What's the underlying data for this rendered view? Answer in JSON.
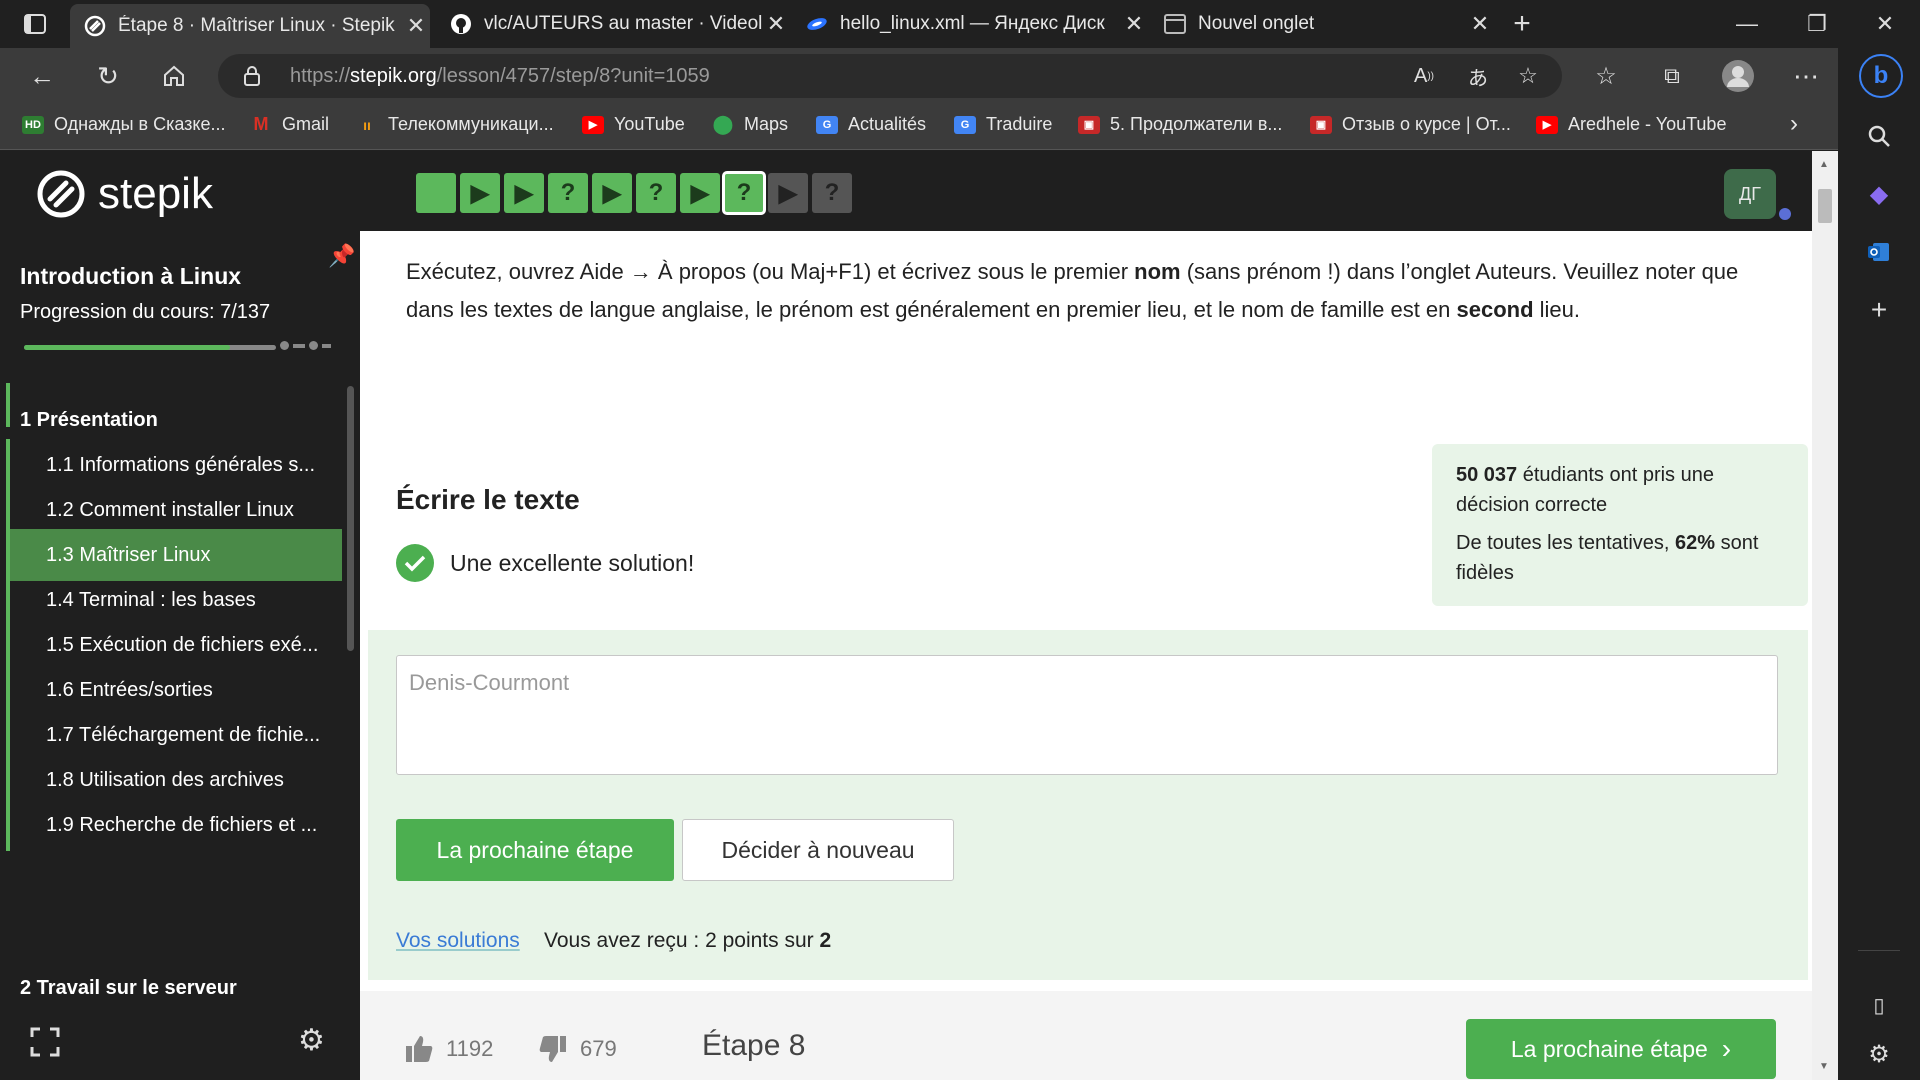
{
  "tabs": [
    {
      "title": "Étape 8 · Maîtriser Linux · Stepik",
      "active": true
    },
    {
      "title": "vlc/AUTEURS au master · Videola",
      "active": false
    },
    {
      "title": "hello_linux.xml — Яндекс Диск",
      "active": false
    },
    {
      "title": "Nouvel onglet",
      "active": false
    }
  ],
  "url": {
    "prefix": "https://",
    "domain": "stepik.org",
    "path": "/lesson/4757/step/8?unit=1059"
  },
  "bookmarks": [
    {
      "label": "Однажды в Сказке...",
      "icon": "hd-icon",
      "color": "#2e7d32"
    },
    {
      "label": "Gmail",
      "icon": "gmail-icon",
      "color": "#d93025"
    },
    {
      "label": "Телекоммуникаци...",
      "icon": "telecom-icon",
      "color": "#f39c12"
    },
    {
      "label": "YouTube",
      "icon": "youtube-icon",
      "color": "#ff0000"
    },
    {
      "label": "Maps",
      "icon": "maps-icon",
      "color": "#34a853"
    },
    {
      "label": "Actualités",
      "icon": "news-icon",
      "color": "#4285f4"
    },
    {
      "label": "Traduire",
      "icon": "translate-icon",
      "color": "#4285f4"
    },
    {
      "label": "5. Продолжатели в...",
      "icon": "video-icon",
      "color": "#c62828"
    },
    {
      "label": "Отзыв о курсе | От...",
      "icon": "video-icon",
      "color": "#c62828"
    },
    {
      "label": "Aredhele - YouTube",
      "icon": "youtube-icon",
      "color": "#ff0000"
    }
  ],
  "stepik": {
    "logo": "stepik",
    "avatar": "ДГ",
    "step_nav": [
      {
        "kind": "solid",
        "state": "green"
      },
      {
        "kind": "play",
        "state": "green"
      },
      {
        "kind": "play",
        "state": "green"
      },
      {
        "kind": "question",
        "state": "green"
      },
      {
        "kind": "play",
        "state": "green"
      },
      {
        "kind": "question",
        "state": "green"
      },
      {
        "kind": "play",
        "state": "green"
      },
      {
        "kind": "question",
        "state": "current"
      },
      {
        "kind": "play",
        "state": "gray"
      },
      {
        "kind": "question",
        "state": "gray"
      }
    ]
  },
  "sidebar": {
    "course_title": "Introduction à Linux",
    "progress_text": "Progression du cours: 7/137",
    "progress_fraction": 0.051,
    "sections": [
      {
        "title": "1 Présentation"
      },
      {
        "title": "2 Travail sur le serveur"
      }
    ],
    "lessons": [
      {
        "label": "1.1 Informations générales s...",
        "active": false
      },
      {
        "label": "1.2 Comment installer Linux",
        "active": false
      },
      {
        "label": "1.3 Maîtriser Linux",
        "active": true
      },
      {
        "label": "1.4 Terminal : les bases",
        "active": false
      },
      {
        "label": "1.5 Exécution de fichiers exé...",
        "active": false
      },
      {
        "label": "1.6 Entrées/sorties",
        "active": false
      },
      {
        "label": "1.7 Téléchargement de fichie...",
        "active": false
      },
      {
        "label": "1.8 Utilisation des archives",
        "active": false
      },
      {
        "label": "1.9 Recherche de fichiers et ...",
        "active": false
      }
    ]
  },
  "main": {
    "instruction": {
      "p1": "Exécutez, ouvrez Aide → À propos (ou Maj+F1) et écrivez sous le premier ",
      "b1": "nom",
      "p2": " (sans prénom !) dans l’onglet Auteurs. Veuillez noter que dans les textes de langue anglaise, le prénom est généralement en premier lieu, et le nom de famille est en ",
      "b2": "second",
      "p3": " lieu."
    },
    "task_title": "Écrire le texte",
    "success_msg": "Une excellente solution!",
    "stats": {
      "count": "50 037",
      "count_text": " étudiants ont pris une décision correcte",
      "attempts_prefix": "De toutes les tentatives, ",
      "percent": "62%",
      "attempts_suffix": " sont fidèles"
    },
    "answer_value": "Denis-Courmont",
    "next_btn": "La prochaine étape",
    "retry_btn": "Décider à nouveau",
    "solutions_link": "Vos solutions",
    "score_text": "Vous avez reçu : 2 points sur ",
    "score_max": "2",
    "likes": "1192",
    "dislikes": "679",
    "step_label": "Étape 8",
    "footer_next": "La prochaine étape"
  }
}
